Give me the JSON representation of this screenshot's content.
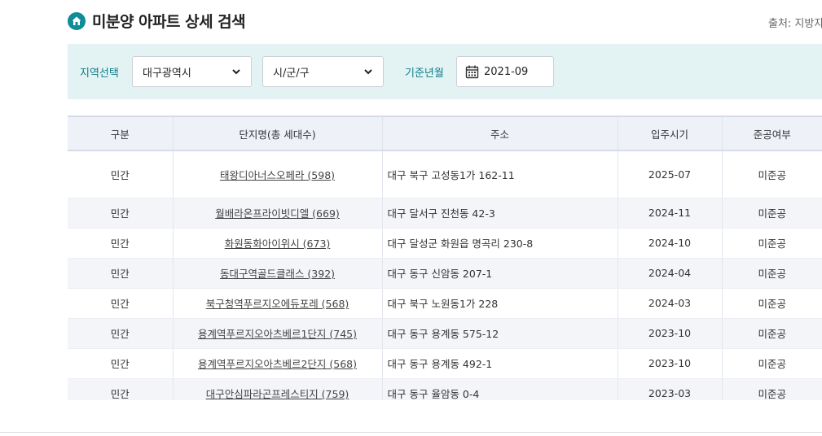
{
  "header": {
    "title": "미분양 아파트 상세 검색",
    "source": "출처: 지방자치단체",
    "icon": "home-icon"
  },
  "filters": {
    "region_label": "지역선택",
    "region_value": "대구광역시",
    "district_value": "시/군/구",
    "date_label": "기준년월",
    "date_value": "2021-09"
  },
  "table": {
    "columns": [
      "구분",
      "단지명(총 세대수)",
      "주소",
      "입주시기",
      "준공여부"
    ],
    "rows": [
      {
        "type": "민간",
        "name": "태왕디아너스오페라 (598)",
        "address": "대구 북구 고성동1가 162-11",
        "move_in": "2025-07",
        "status": "미준공"
      },
      {
        "type": "민간",
        "name": "월배라온프라이빗디엘 (669)",
        "address": "대구 달서구 진천동 42-3",
        "move_in": "2024-11",
        "status": "미준공"
      },
      {
        "type": "민간",
        "name": "화원동화아이위시 (673)",
        "address": "대구 달성군 화원읍 명곡리 230-8",
        "move_in": "2024-10",
        "status": "미준공"
      },
      {
        "type": "민간",
        "name": "동대구역골드클래스 (392)",
        "address": "대구 동구 신암동 207-1",
        "move_in": "2024-04",
        "status": "미준공"
      },
      {
        "type": "민간",
        "name": "북구청역푸르지오에듀포레 (568)",
        "address": "대구 북구 노원동1가 228",
        "move_in": "2024-03",
        "status": "미준공"
      },
      {
        "type": "민간",
        "name": "용계역푸르지오아츠베르1단지 (745)",
        "address": "대구 동구 용계동 575-12",
        "move_in": "2023-10",
        "status": "미준공"
      },
      {
        "type": "민간",
        "name": "용계역푸르지오아츠베르2단지 (568)",
        "address": "대구 동구 용계동 492-1",
        "move_in": "2023-10",
        "status": "미준공"
      },
      {
        "type": "민간",
        "name": "대구안심파라곤프레스티지 (759)",
        "address": "대구 동구 율암동 0-4",
        "move_in": "2023-03",
        "status": "미준공"
      }
    ]
  },
  "colors": {
    "accent": "#0e8c97",
    "filter_bg": "#e3f2f2",
    "header_bg": "#eef1f7"
  }
}
